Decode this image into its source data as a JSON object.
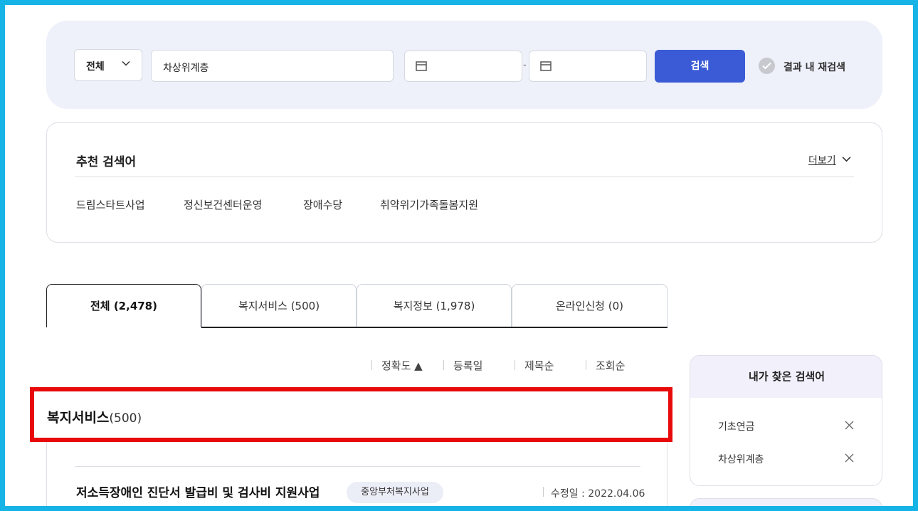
{
  "search": {
    "category": "전체",
    "keyword": "차상위계층",
    "date_separator": "-",
    "button": "검색",
    "research_label": "결과 내 재검색"
  },
  "recommend": {
    "title": "추천 검색어",
    "more": "더보기",
    "items": [
      "드림스타트사업",
      "정신보건센터운영",
      "장애수당",
      "취약위기가족돌봄지원"
    ]
  },
  "tabs": [
    {
      "label": "전체  (2,478)"
    },
    {
      "label": "복지서비스 (500)"
    },
    {
      "label": "복지정보 (1,978)"
    },
    {
      "label": "온라인신청 (0)"
    }
  ],
  "sort": [
    "정확도 ▲",
    "등록일",
    "제목순",
    "조회순"
  ],
  "section": {
    "title": "복지서비스",
    "count": "(500)"
  },
  "result": {
    "title": "저소득장애인 진단서 발급비 및 검사비 지원사업",
    "badge": "중앙부처복지사업",
    "modified": "수정일 : 2022.04.06"
  },
  "sidebar": {
    "title": "내가 찾은 검색어",
    "items": [
      "기초연금",
      "차상위계층"
    ]
  },
  "colors": {
    "frame": "#16b3e6",
    "highlight": "#e80a0a",
    "primary": "#3b5bd6",
    "panel": "#eef0fa"
  }
}
